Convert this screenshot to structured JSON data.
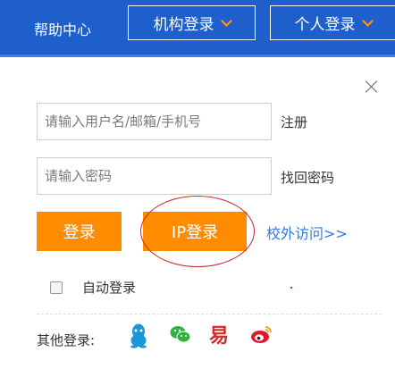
{
  "header": {
    "help_center": "帮助中心",
    "org_login": "机构登录",
    "personal_login": "个人登录"
  },
  "form": {
    "username_placeholder": "请输入用户名/邮箱/手机号",
    "password_placeholder": "请输入密码",
    "register": "注册",
    "forgot_password": "找回密码",
    "login_button": "登录",
    "ip_login_button": "IP登录",
    "off_campus_access": "校外访问>>",
    "auto_login_label": "自动登录"
  },
  "social": {
    "label": "其他登录:",
    "yi_glyph": "易",
    "icons": [
      "qq-icon",
      "wechat-icon",
      "netease-icon",
      "weibo-icon"
    ]
  },
  "colors": {
    "header_bg": "#1f5fcc",
    "accent_orange": "#ff8c00",
    "link_blue": "#2f7de1",
    "highlight_circle": "#d02020"
  }
}
